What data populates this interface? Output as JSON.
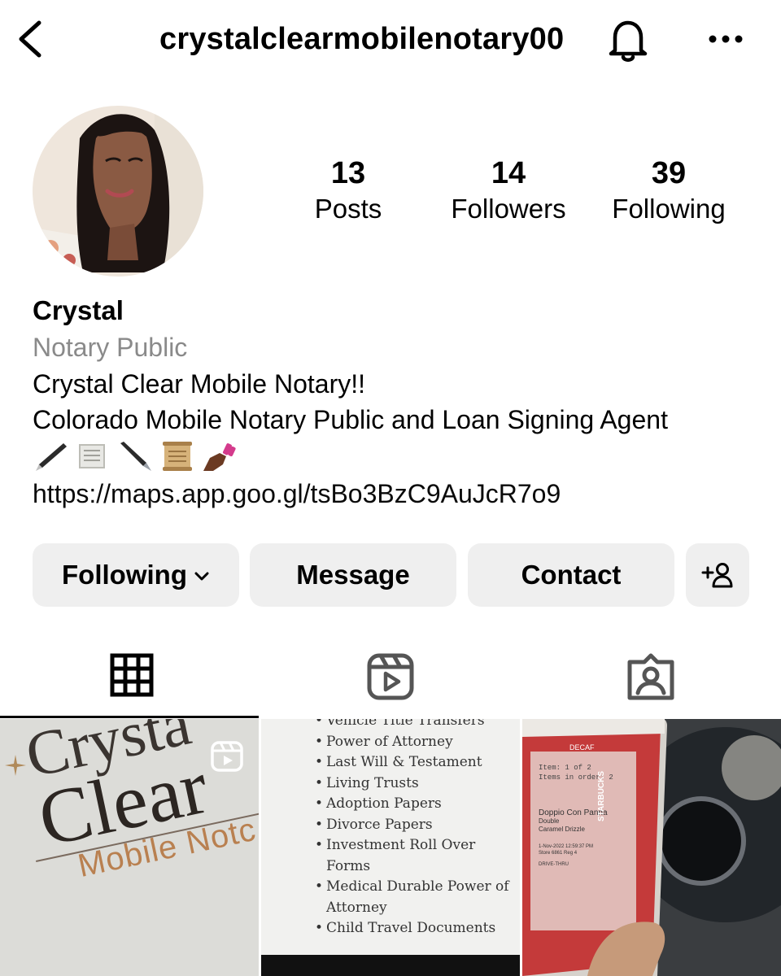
{
  "header": {
    "username": "crystalclearmobilenotary00",
    "back_icon": "chevron-left-icon",
    "bell_icon": "bell-icon",
    "more_icon": "more-horizontal-icon"
  },
  "profile": {
    "stats": {
      "posts": {
        "value": "13",
        "label": "Posts"
      },
      "followers": {
        "value": "14",
        "label": "Followers"
      },
      "following": {
        "value": "39",
        "label": "Following"
      }
    },
    "name": "Crystal",
    "category": "Notary Public",
    "bio_line1": "Crystal Clear Mobile Notary!!",
    "bio_line2": "Colorado Mobile Notary Public and Loan Signing Agent",
    "bio_emojis": [
      "pen-emoji",
      "scroll-page-emoji",
      "fountain-pen-emoji",
      "scroll-emoji",
      "nail-polish-emoji"
    ],
    "link": "https://maps.app.goo.gl/tsBo3BzC9AuJcR7o9"
  },
  "actions": {
    "following_label": "Following",
    "message_label": "Message",
    "contact_label": "Contact",
    "add_icon": "add-person-icon"
  },
  "tabs": [
    {
      "name": "grid",
      "icon": "grid-icon",
      "active": true
    },
    {
      "name": "reels",
      "icon": "reels-icon",
      "active": false
    },
    {
      "name": "tagged",
      "icon": "tagged-person-icon",
      "active": false
    }
  ],
  "posts": {
    "post1": {
      "line1": "Crysta",
      "line2": "Clear",
      "line3": "Mobile Notc"
    },
    "post2": {
      "items": [
        "Vehicle Title Transfers",
        "Power of Attorney",
        "Last Will & Testament",
        "Living Trusts",
        "Adoption Papers",
        "Divorce Papers",
        "Investment Roll Over",
        "Forms",
        "Medical Durable Power of",
        "Attorney",
        "Child Travel Documents"
      ]
    },
    "post3": {
      "cup_top": "DECAF",
      "cup_l1": "Item: 1 of 2",
      "cup_l2": "Items in order: 2",
      "cup_l3": "Doppio Con Panna",
      "cup_l4": "Double",
      "cup_l5": "Caramel Drizzle",
      "cup_l6": "1-Nov-2022   12:59:37 PM",
      "cup_l7": "Store 6861   Reg 4",
      "cup_l8": "DRIVE-THRU",
      "cup_side": "STARBUCKS"
    }
  },
  "colors": {
    "button_bg": "#efefef",
    "muted_text": "#8a8a8a",
    "text": "#000000"
  }
}
